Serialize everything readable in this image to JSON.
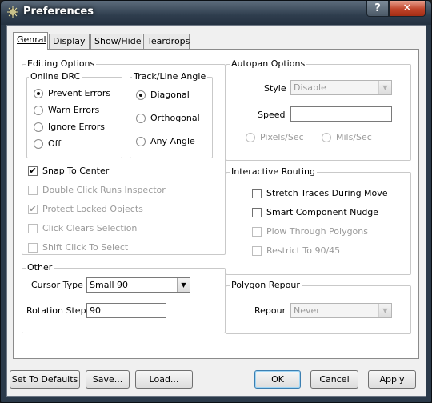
{
  "window": {
    "title": "Preferences",
    "help_label": "?",
    "close_label": "✕",
    "icon": "chip-icon"
  },
  "tabs": [
    {
      "label": "Genral",
      "active": true
    },
    {
      "label": "Display",
      "active": false
    },
    {
      "label": "Show/Hide",
      "active": false
    },
    {
      "label": "Teardrops",
      "active": false
    }
  ],
  "editing_options": {
    "title": "Editing Options",
    "online_drc": {
      "title": "Online DRC",
      "options": [
        "Prevent Errors",
        "Warn Errors",
        "Ignore Errors",
        "Off"
      ],
      "selected": "Prevent Errors"
    },
    "track_angle": {
      "title": "Track/Line Angle",
      "options": [
        "Diagonal",
        "Orthogonal",
        "Any Angle"
      ],
      "selected": "Diagonal"
    },
    "checks": [
      {
        "label": "Snap To Center",
        "checked": true,
        "enabled": true
      },
      {
        "label": "Double Click Runs Inspector",
        "checked": false,
        "enabled": false
      },
      {
        "label": "Protect Locked Objects",
        "checked": true,
        "enabled": false
      },
      {
        "label": "Click Clears Selection",
        "checked": false,
        "enabled": false
      },
      {
        "label": "Shift Click To Select",
        "checked": false,
        "enabled": false
      }
    ]
  },
  "other": {
    "title": "Other",
    "cursor_type_label": "Cursor Type",
    "cursor_type_value": "Small 90",
    "rotation_step_label": "Rotation Step",
    "rotation_step_value": "90"
  },
  "autopan": {
    "title": "Autopan Options",
    "style_label": "Style",
    "style_value": "Disable",
    "speed_label": "Speed",
    "speed_value": "",
    "units": [
      "Pixels/Sec",
      "Mils/Sec"
    ]
  },
  "interactive_routing": {
    "title": "Interactive Routing",
    "checks": [
      {
        "label": "Stretch Traces During Move",
        "checked": false,
        "enabled": true
      },
      {
        "label": "Smart Component Nudge",
        "checked": false,
        "enabled": true
      },
      {
        "label": "Plow Through Polygons",
        "checked": false,
        "enabled": false
      },
      {
        "label": "Restrict To 90/45",
        "checked": false,
        "enabled": false
      }
    ]
  },
  "polygon_repour": {
    "title": "Polygon Repour",
    "repour_label": "Repour",
    "repour_value": "Never"
  },
  "buttons": {
    "set_defaults": "Set To Defaults",
    "save": "Save...",
    "load": "Load...",
    "ok": "OK",
    "cancel": "Cancel",
    "apply": "Apply"
  }
}
